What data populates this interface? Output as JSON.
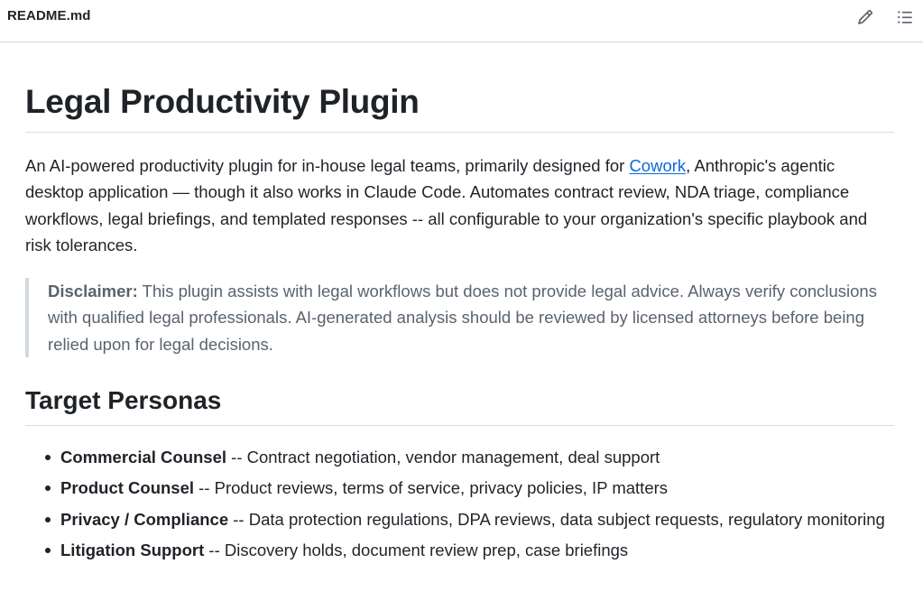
{
  "file": {
    "name": "README.md",
    "edit_icon": "pencil-icon",
    "outline_icon": "list-unordered-icon"
  },
  "doc": {
    "title": "Legal Productivity Plugin",
    "intro": {
      "before_link": "An AI-powered productivity plugin for in-house legal teams, primarily designed for ",
      "link_text": "Cowork",
      "after_link": ", Anthropic's agentic desktop application — though it also works in Claude Code. Automates contract review, NDA triage, compliance workflows, legal briefings, and templated responses -- all configurable to your organization's specific playbook and risk tolerances."
    },
    "disclaimer": {
      "label": "Disclaimer:",
      "text": " This plugin assists with legal workflows but does not provide legal advice. Always verify conclusions with qualified legal professionals. AI-generated analysis should be reviewed by licensed attorneys before being relied upon for legal decisions."
    },
    "section_heading": "Target Personas",
    "personas": [
      {
        "name": "Commercial Counsel",
        "description": " -- Contract negotiation, vendor management, deal support"
      },
      {
        "name": "Product Counsel",
        "description": " -- Product reviews, terms of service, privacy policies, IP matters"
      },
      {
        "name": "Privacy / Compliance",
        "description": " -- Data protection regulations, DPA reviews, data subject requests, regulatory monitoring"
      },
      {
        "name": "Litigation Support",
        "description": " -- Discovery holds, document review prep, case briefings"
      }
    ]
  },
  "colors": {
    "link": "#0969da",
    "text": "#1f2328",
    "muted": "#59636e",
    "border": "#d1d9e0"
  }
}
